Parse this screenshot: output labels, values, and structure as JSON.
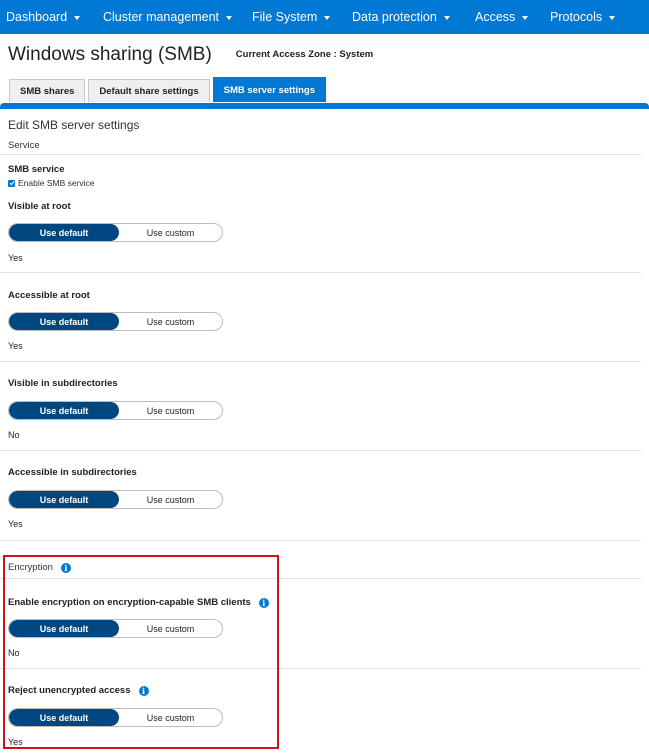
{
  "topnav": {
    "items": [
      {
        "label": "Dashboard"
      },
      {
        "label": "Cluster management"
      },
      {
        "label": "File System"
      },
      {
        "label": "Data protection"
      },
      {
        "label": "Access"
      },
      {
        "label": "Protocols"
      }
    ]
  },
  "header": {
    "title": "Windows sharing (SMB)",
    "access_zone": "Current Access Zone : System"
  },
  "tabs": [
    {
      "label": "SMB shares"
    },
    {
      "label": "Default share settings"
    },
    {
      "label": "SMB server settings"
    }
  ],
  "form": {
    "heading": "Edit SMB server settings",
    "service_section": "Service",
    "smb_service": {
      "label": "SMB service",
      "checkbox_label": "Enable SMB service",
      "checked": true
    },
    "fields": [
      {
        "label": "Visible at root",
        "default_label": "Use default",
        "custom_label": "Use custom",
        "value": "Yes"
      },
      {
        "label": "Accessible at root",
        "default_label": "Use default",
        "custom_label": "Use custom",
        "value": "Yes"
      },
      {
        "label": "Visible in subdirectories",
        "default_label": "Use default",
        "custom_label": "Use custom",
        "value": "No"
      },
      {
        "label": "Accessible in subdirectories",
        "default_label": "Use default",
        "custom_label": "Use custom",
        "value": "Yes"
      }
    ],
    "encryption_section": "Encryption",
    "encryption_fields": [
      {
        "label": "Enable encryption on encryption-capable SMB clients",
        "default_label": "Use default",
        "custom_label": "Use custom",
        "value": "No"
      },
      {
        "label": "Reject unencrypted access",
        "default_label": "Use default",
        "custom_label": "Use custom",
        "value": "Yes"
      }
    ]
  },
  "icons": {
    "info": "i",
    "info_name": "info-icon",
    "caret_name": "chevron-down-icon",
    "check_name": "check-icon"
  },
  "colors": {
    "nav_bg": "#0078d4",
    "toggle_active": "#00477f",
    "highlight": "#d0121b"
  }
}
